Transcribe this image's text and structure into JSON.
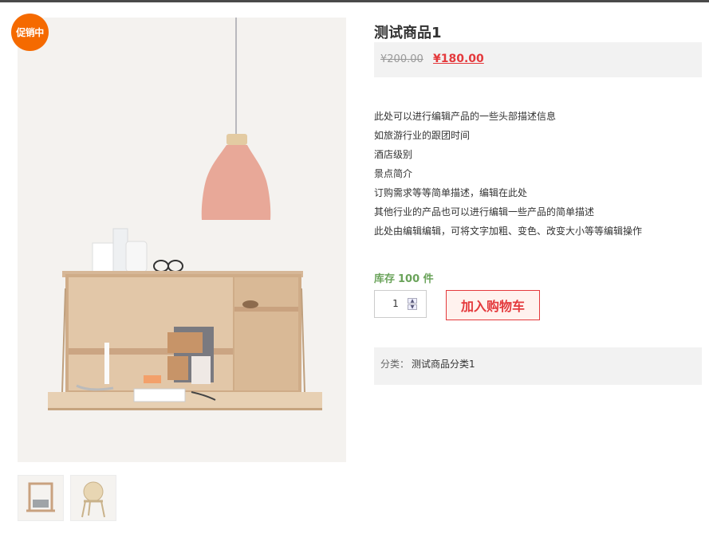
{
  "product": {
    "badge": "促销中",
    "title": "测试商品1",
    "old_price": "¥200.00",
    "new_price": "¥180.00",
    "description": [
      "此处可以进行编辑产品的一些头部描述信息",
      "如旅游行业的跟团时间",
      "酒店级别",
      "景点简介",
      "订购需求等等简单描述，编辑在此处",
      "其他行业的产品也可以进行编辑一些产品的简单描述",
      "此处由编辑编辑，可将文字加粗、变色、改变大小等等编辑操作"
    ],
    "stock_label": "库存",
    "stock_value": "100 件",
    "quantity": "1",
    "add_to_cart": "加入购物车",
    "category_label": "分类：",
    "category_value": "测试商品分类1"
  },
  "colors": {
    "promo": "#f56a00",
    "price": "#e4393c",
    "stock": "#6aa35a"
  }
}
